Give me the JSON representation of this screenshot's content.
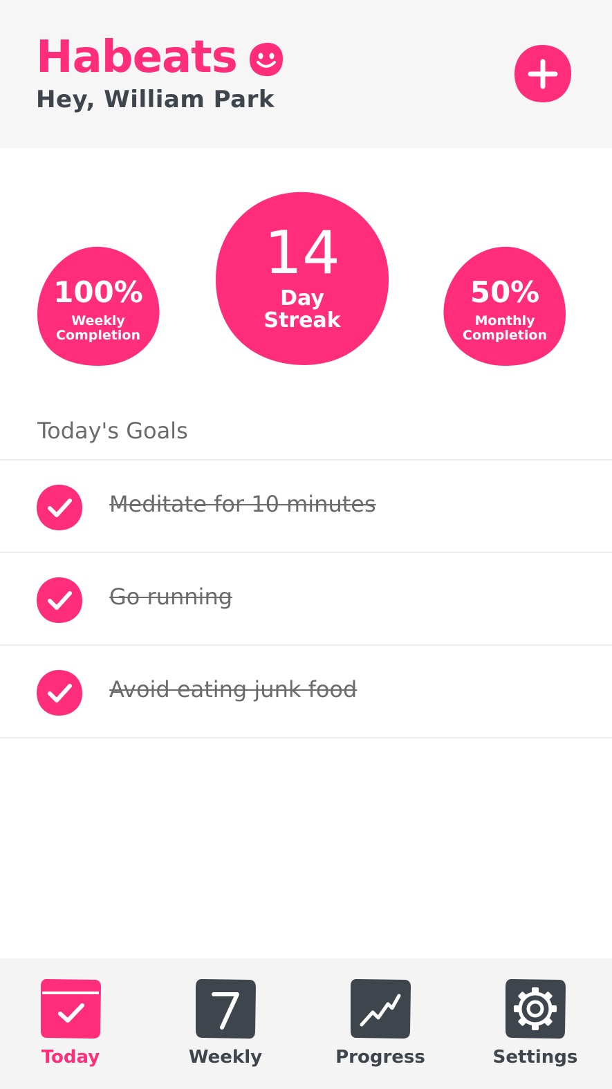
{
  "app": {
    "name": "Habeats",
    "greeting": "Hey, William Park"
  },
  "colors": {
    "accent": "#ff2d7a",
    "dark": "#3f454d",
    "muted": "#6b6b6b",
    "header_bg": "#f6f6f6"
  },
  "stats": {
    "weekly": {
      "value": "100%",
      "label": "Weekly Completion"
    },
    "streak": {
      "value": "14",
      "label": "Day Streak"
    },
    "monthly": {
      "value": "50%",
      "label": "Monthly Completion"
    }
  },
  "goals": {
    "title": "Today's Goals",
    "items": [
      {
        "label": "Meditate for 10 minutes",
        "done": true
      },
      {
        "label": "Go running",
        "done": true
      },
      {
        "label": "Avoid eating junk food",
        "done": true
      }
    ]
  },
  "tabs": [
    {
      "label": "Today",
      "icon": "calendar-check-icon",
      "active": true
    },
    {
      "label": "Weekly",
      "icon": "calendar-seven-icon",
      "active": false
    },
    {
      "label": "Progress",
      "icon": "trend-chart-icon",
      "active": false
    },
    {
      "label": "Settings",
      "icon": "gear-icon",
      "active": false
    }
  ]
}
